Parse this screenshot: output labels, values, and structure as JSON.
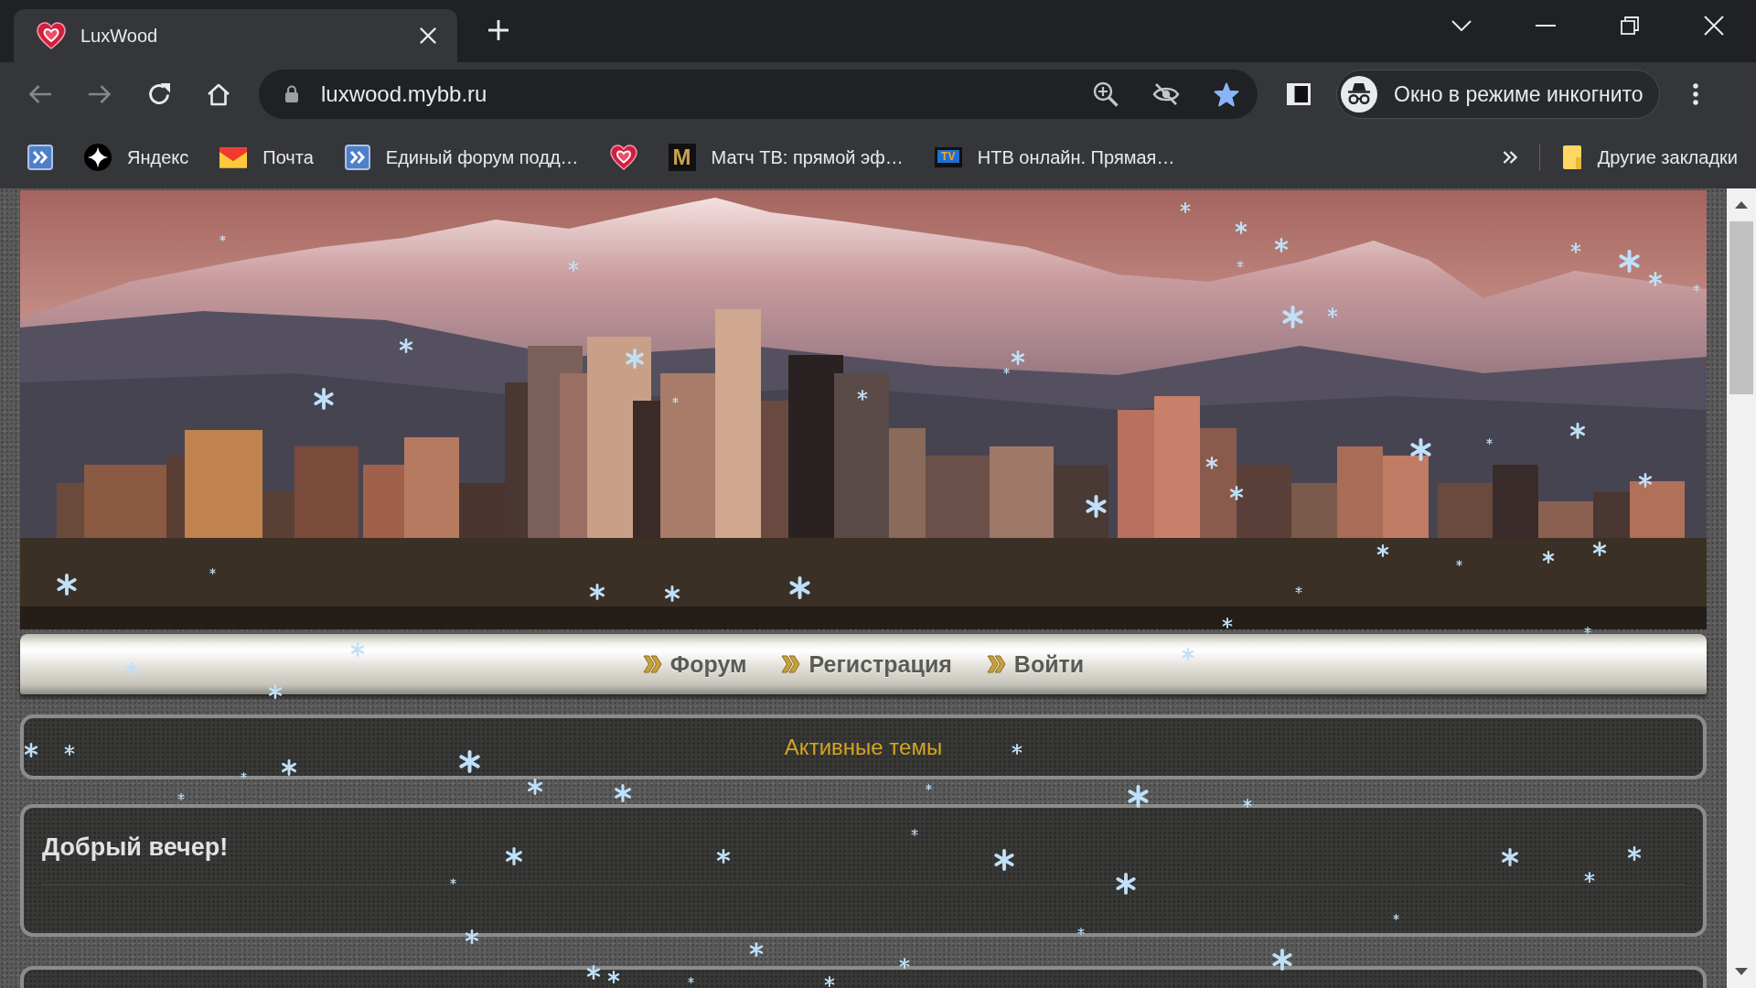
{
  "browser": {
    "tabs": [
      {
        "title": "LuxWood",
        "selected": true
      }
    ],
    "toolbar": [
      {
        "kind": "back",
        "disabled": true
      },
      {
        "kind": "forward",
        "disabled": true
      },
      {
        "kind": "reload",
        "disabled": false
      },
      {
        "kind": "home",
        "disabled": false
      }
    ],
    "address_bar": {
      "url": "luxwood.mybb.ru",
      "bookmarked": true
    },
    "profile": {
      "label": "Окно в режиме инкогнито"
    },
    "bookmarks": [
      {
        "kind": "icon"
      },
      {
        "kind": "link",
        "label": "Яндекс"
      },
      {
        "kind": "link",
        "label": "Почта"
      },
      {
        "kind": "link",
        "label": "Единый форум подд…"
      },
      {
        "kind": "icon"
      },
      {
        "kind": "link",
        "label": "Матч ТВ: прямой эф…",
        "icon_text": "M"
      },
      {
        "kind": "link",
        "label": "НТВ онлайн. Прямая…",
        "icon_text": "TV"
      }
    ],
    "other_bookmarks": {
      "label": "Другие закладки"
    }
  },
  "forum": {
    "nav": [
      {
        "label": "Форум"
      },
      {
        "label": "Регистрация"
      },
      {
        "label": "Войти"
      }
    ],
    "active_topics": {
      "label": "Активные темы"
    },
    "greeting": {
      "title": "Добрый вечер!"
    }
  }
}
